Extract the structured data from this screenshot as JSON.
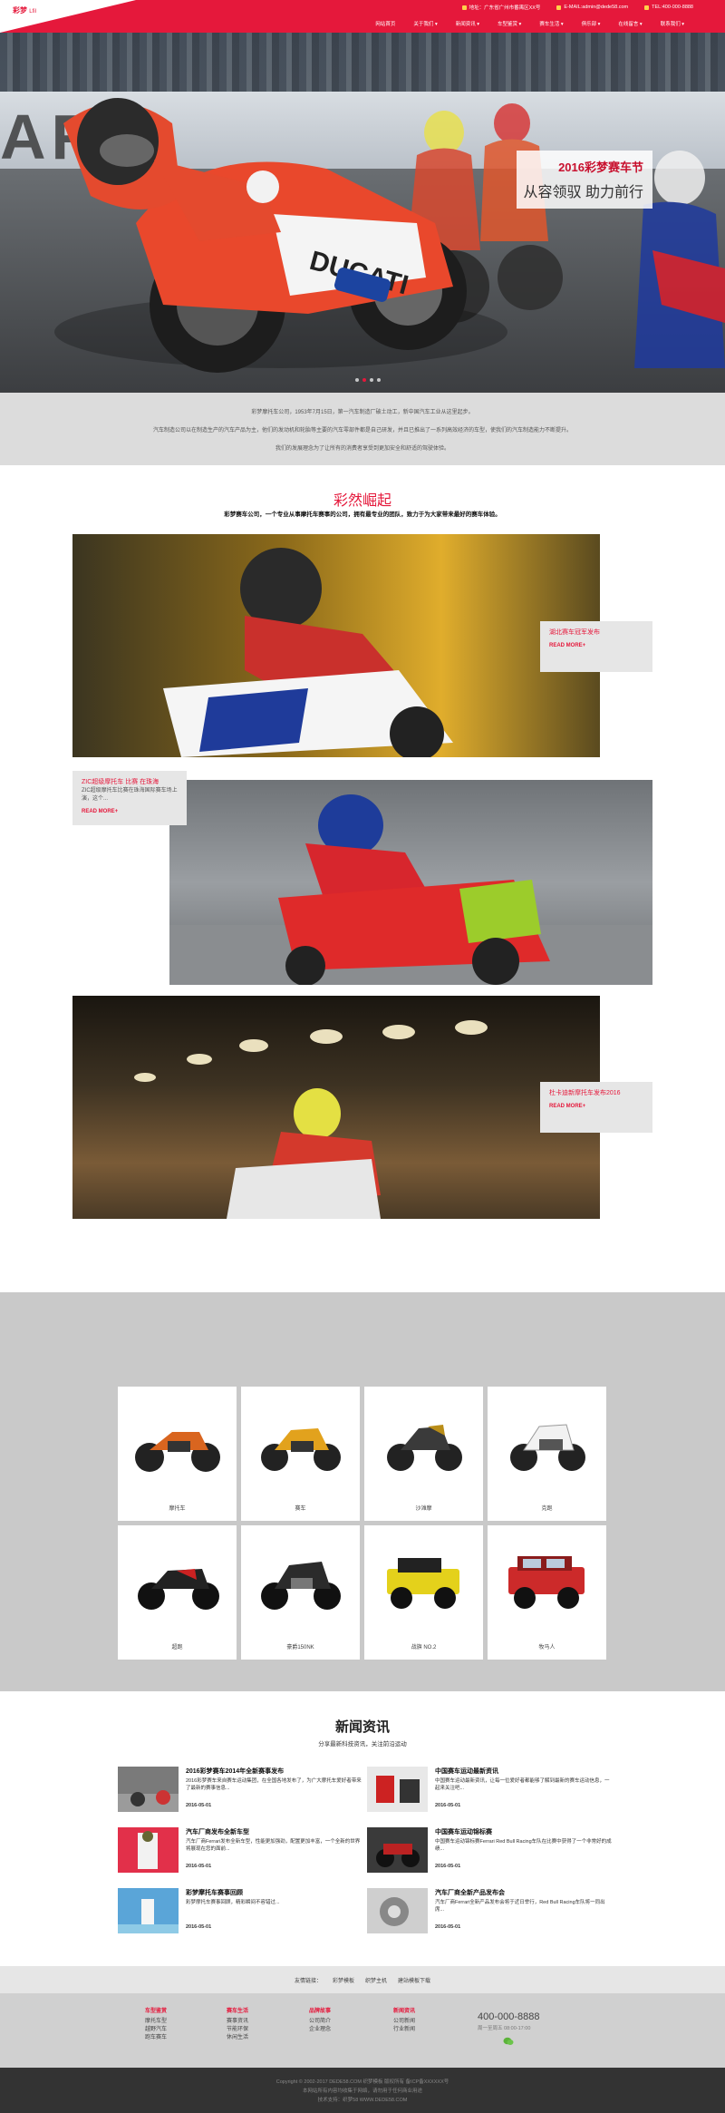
{
  "header": {
    "logo": "彩梦",
    "logo_tag": "Lfil",
    "top_info": [
      {
        "icon": "location-icon",
        "text": "地址：广东省广州市番禺区XX号"
      },
      {
        "icon": "mail-icon",
        "text": "E-MAIL:admin@dede58.com"
      },
      {
        "icon": "phone-icon",
        "text": "TEL:400-000-8888"
      }
    ],
    "nav": [
      "网站首页",
      "关于我们 ▾",
      "新闻资讯 ▾",
      "车型鉴赏 ▾",
      "赛车生活 ▾",
      "俱乐部 ▾",
      "在线留言 ▾",
      "联系我们 ▾"
    ],
    "colors": {
      "brand": "#e5183b",
      "top_icon": "#ffd24a"
    }
  },
  "hero": {
    "wall_text": "ARE",
    "caption_line1": "2016彩梦赛车节",
    "caption_line2": "从容领驭 助力前行",
    "slides": 4,
    "active_slide": 2
  },
  "intro": {
    "p1": "彩梦摩托车公司，1953年7月15日，第一汽车制造厂破土动工，新中国汽车工业从这里起步。",
    "p2": "汽车制造公司以在制造生产的汽车产品为主，他们的发动机和轮胎等主要的汽车零部件都是自己研发，并且已推出了一系列高效经济的车型，使我们的汽车制造能力不断提升。",
    "p3": "我们的发展理念为了让所有的消费者享受到更加安全和舒适的驾驶体验。"
  },
  "section1": {
    "title": "彩然崛起",
    "subtitle": "彩梦赛车公司，一个专业从事摩托车赛事的公司，拥有最专业的团队，致力于为大家带来最好的赛车体验。",
    "cards": [
      {
        "title": "湖北赛车冠军发布",
        "desc": "",
        "more": "READ MORE+"
      },
      {
        "title": "ZIC超级摩托车 比赛 在珠海",
        "desc": "ZIC超级摩托车比赛在珠海国际赛车场上演，这个...",
        "more": "READ MORE+"
      },
      {
        "title": "杜卡迪新摩托车发布2016",
        "desc": "",
        "more": "READ MORE+"
      }
    ]
  },
  "products": {
    "items": [
      {
        "label": "摩托车",
        "color": "#d9651f"
      },
      {
        "label": "赛车",
        "color": "#e2a21d"
      },
      {
        "label": "沙滩摩",
        "color": "#b98d18"
      },
      {
        "label": "克跑",
        "color": "#9aa0a6"
      },
      {
        "label": "超跑",
        "color": "#222222"
      },
      {
        "label": "豪爵150NK",
        "color": "#2b2b2b"
      },
      {
        "label": "战旗 NO.2",
        "color": "#e4d11b"
      },
      {
        "label": "牧马人",
        "color": "#cc2a2a"
      }
    ]
  },
  "news": {
    "title": "新闻资讯",
    "subtitle": "分享最新科技资讯，关注前沿运动",
    "items": [
      {
        "title": "2016彩梦赛车2014年全新赛事发布",
        "desc": "2016彩梦赛车来自赛车运动集团，在全国各地发布了，为广大摩托车爱好者带来了最新的赛事信息...",
        "date": "2016-05-01"
      },
      {
        "title": "中国赛车运动最新资讯",
        "desc": "中国赛车运动最新资讯，让每一位爱好者都能够了解到最新的赛车运动信息，一起来关注吧...",
        "date": "2016-05-01"
      },
      {
        "title": "汽车厂商发布全新车型",
        "desc": "汽车厂商Ferrari发布全新车型，性能更加强劲，配置更加丰富，一个全新的世界将展现在您的面前...",
        "date": "2016-05-01"
      },
      {
        "title": "中国赛车运动锦标赛",
        "desc": "中国赛车运动锦标赛Ferrari Red Bull Racing车队在比赛中获得了一个非常好的成绩...",
        "date": "2016-05-01"
      },
      {
        "title": "彩梦摩托车赛事回顾",
        "desc": "彩梦摩托车赛事回顾，精彩瞬间不容错过...",
        "date": "2016-05-01"
      },
      {
        "title": "汽车厂商全新产品发布会",
        "desc": "汽车厂商Ferrari全新产品发布会将于近日举行，Red Bull Racing车队将一同出席...",
        "date": "2016-05-01"
      }
    ]
  },
  "links": {
    "label": "友情链接：",
    "items": [
      "彩梦模板",
      "织梦主机",
      "建站模板下载"
    ]
  },
  "footer": {
    "columns": [
      {
        "title": "车型鉴赏",
        "items": [
          "摩托车型",
          "越野汽车",
          "跑车赛车"
        ]
      },
      {
        "title": "赛车生活",
        "items": [
          "赛事资讯",
          "节能环保",
          "休闲生活"
        ]
      },
      {
        "title": "品牌故事",
        "items": [
          "公司简介",
          "企业理念"
        ]
      },
      {
        "title": "新闻资讯",
        "items": [
          "公司新闻",
          "行业新闻"
        ]
      }
    ],
    "phone": "400-000-8888",
    "phone_sub": "周一至周五 08:00-17:00",
    "copyright1": "Copyright © 2002-2017 DEDE58.COM 织梦模板 版权所有 备ICP备XXXXXX号",
    "copyright2": "本网站所有内容均收集于网络，请勿用于任何商业用途",
    "copyright3": "技术支持：织梦58 WWW.DEDE58.COM"
  }
}
